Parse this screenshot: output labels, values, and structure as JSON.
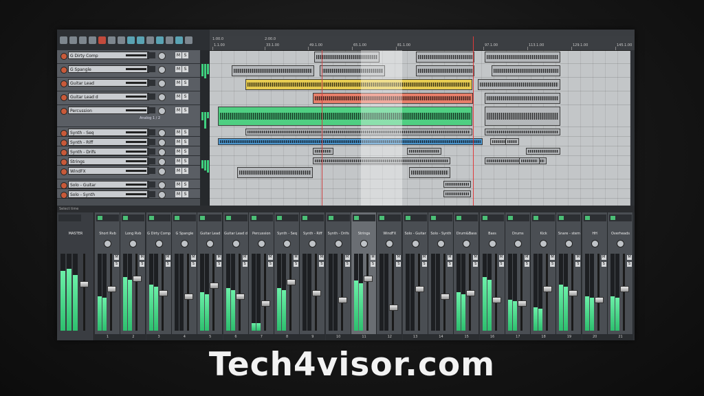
{
  "ruler": {
    "marks": [
      "1.1.00",
      "33.1.00",
      "49.1.00",
      "65.1.00",
      "81.1.00",
      "97.1.00",
      "113.1.00",
      "129.1.00",
      "145.1.00"
    ],
    "sub_marks": [
      "1:00.0",
      "2:00.0"
    ]
  },
  "tracks": [
    {
      "name": "G Dirty Comp",
      "m": "M",
      "s": "S"
    },
    {
      "name": "G Spangle",
      "m": "M",
      "s": "S"
    },
    {
      "name": "Guitar Lead",
      "m": "M",
      "s": "S"
    },
    {
      "name": "Guitar Lead d",
      "m": "M",
      "s": "S"
    },
    {
      "name": "Percussion",
      "m": "M",
      "s": "S",
      "input": "Analog 1 / 2"
    },
    {
      "name": "Synth - Seq",
      "m": "M",
      "s": "S"
    },
    {
      "name": "Synth - Riff",
      "m": "M",
      "s": "S"
    },
    {
      "name": "Synth - Drifs",
      "m": "M",
      "s": "S"
    },
    {
      "name": "Strings",
      "m": "M",
      "s": "S"
    },
    {
      "name": "WindFX",
      "m": "M",
      "s": "S"
    },
    {
      "name": "Solo - Guitar",
      "m": "M",
      "s": "S"
    },
    {
      "name": "Solo - Synth",
      "m": "M",
      "s": "S"
    }
  ],
  "mixer": {
    "header": "Select time",
    "master": {
      "name": "MASTER"
    },
    "channels": [
      {
        "name": "Short Rvb",
        "num": "1",
        "level": 0.45,
        "fader": 0.55
      },
      {
        "name": "Long Rvb",
        "num": "2",
        "level": 0.7,
        "fader": 0.7
      },
      {
        "name": "G Dirty Comp",
        "num": "3",
        "level": 0.6,
        "fader": 0.5
      },
      {
        "name": "G Spangle",
        "num": "4",
        "level": 0.0,
        "fader": 0.45
      },
      {
        "name": "Guitar Lead",
        "num": "5",
        "level": 0.5,
        "fader": 0.6
      },
      {
        "name": "Guitar Lead d",
        "num": "6",
        "level": 0.55,
        "fader": 0.45
      },
      {
        "name": "Percussion",
        "num": "7",
        "level": 0.1,
        "fader": 0.35
      },
      {
        "name": "Synth - Seq",
        "num": "8",
        "level": 0.55,
        "fader": 0.65
      },
      {
        "name": "Synth - Riff",
        "num": "9",
        "level": 0.0,
        "fader": 0.5
      },
      {
        "name": "Synth - Drifs",
        "num": "10",
        "level": 0.0,
        "fader": 0.4
      },
      {
        "name": "Strings",
        "num": "11",
        "level": 0.65,
        "fader": 0.7,
        "selected": true
      },
      {
        "name": "WindFX",
        "num": "12",
        "level": 0.0,
        "fader": 0.3
      },
      {
        "name": "Solo - Guitar",
        "num": "13",
        "level": 0.0,
        "fader": 0.55
      },
      {
        "name": "Solo - Synth",
        "num": "14",
        "level": 0.0,
        "fader": 0.45
      },
      {
        "name": "Drum&Bass",
        "num": "15",
        "level": 0.5,
        "fader": 0.5
      },
      {
        "name": "Bass",
        "num": "16",
        "level": 0.7,
        "fader": 0.4
      },
      {
        "name": "Drums",
        "num": "17",
        "level": 0.4,
        "fader": 0.35
      },
      {
        "name": "Kick",
        "num": "18",
        "level": 0.3,
        "fader": 0.55
      },
      {
        "name": "Snare - stem",
        "num": "19",
        "level": 0.6,
        "fader": 0.5
      },
      {
        "name": "HH",
        "num": "20",
        "level": 0.45,
        "fader": 0.4
      },
      {
        "name": "Overheads",
        "num": "21",
        "level": 0.45,
        "fader": 0.55
      }
    ]
  },
  "brand": "Tech4visor.com",
  "colors": {
    "green": "#4fcf82",
    "yellow": "#e7cc52",
    "red": "#e77f6a",
    "blue": "#4d97cf",
    "cursor": "#e03a3a"
  }
}
